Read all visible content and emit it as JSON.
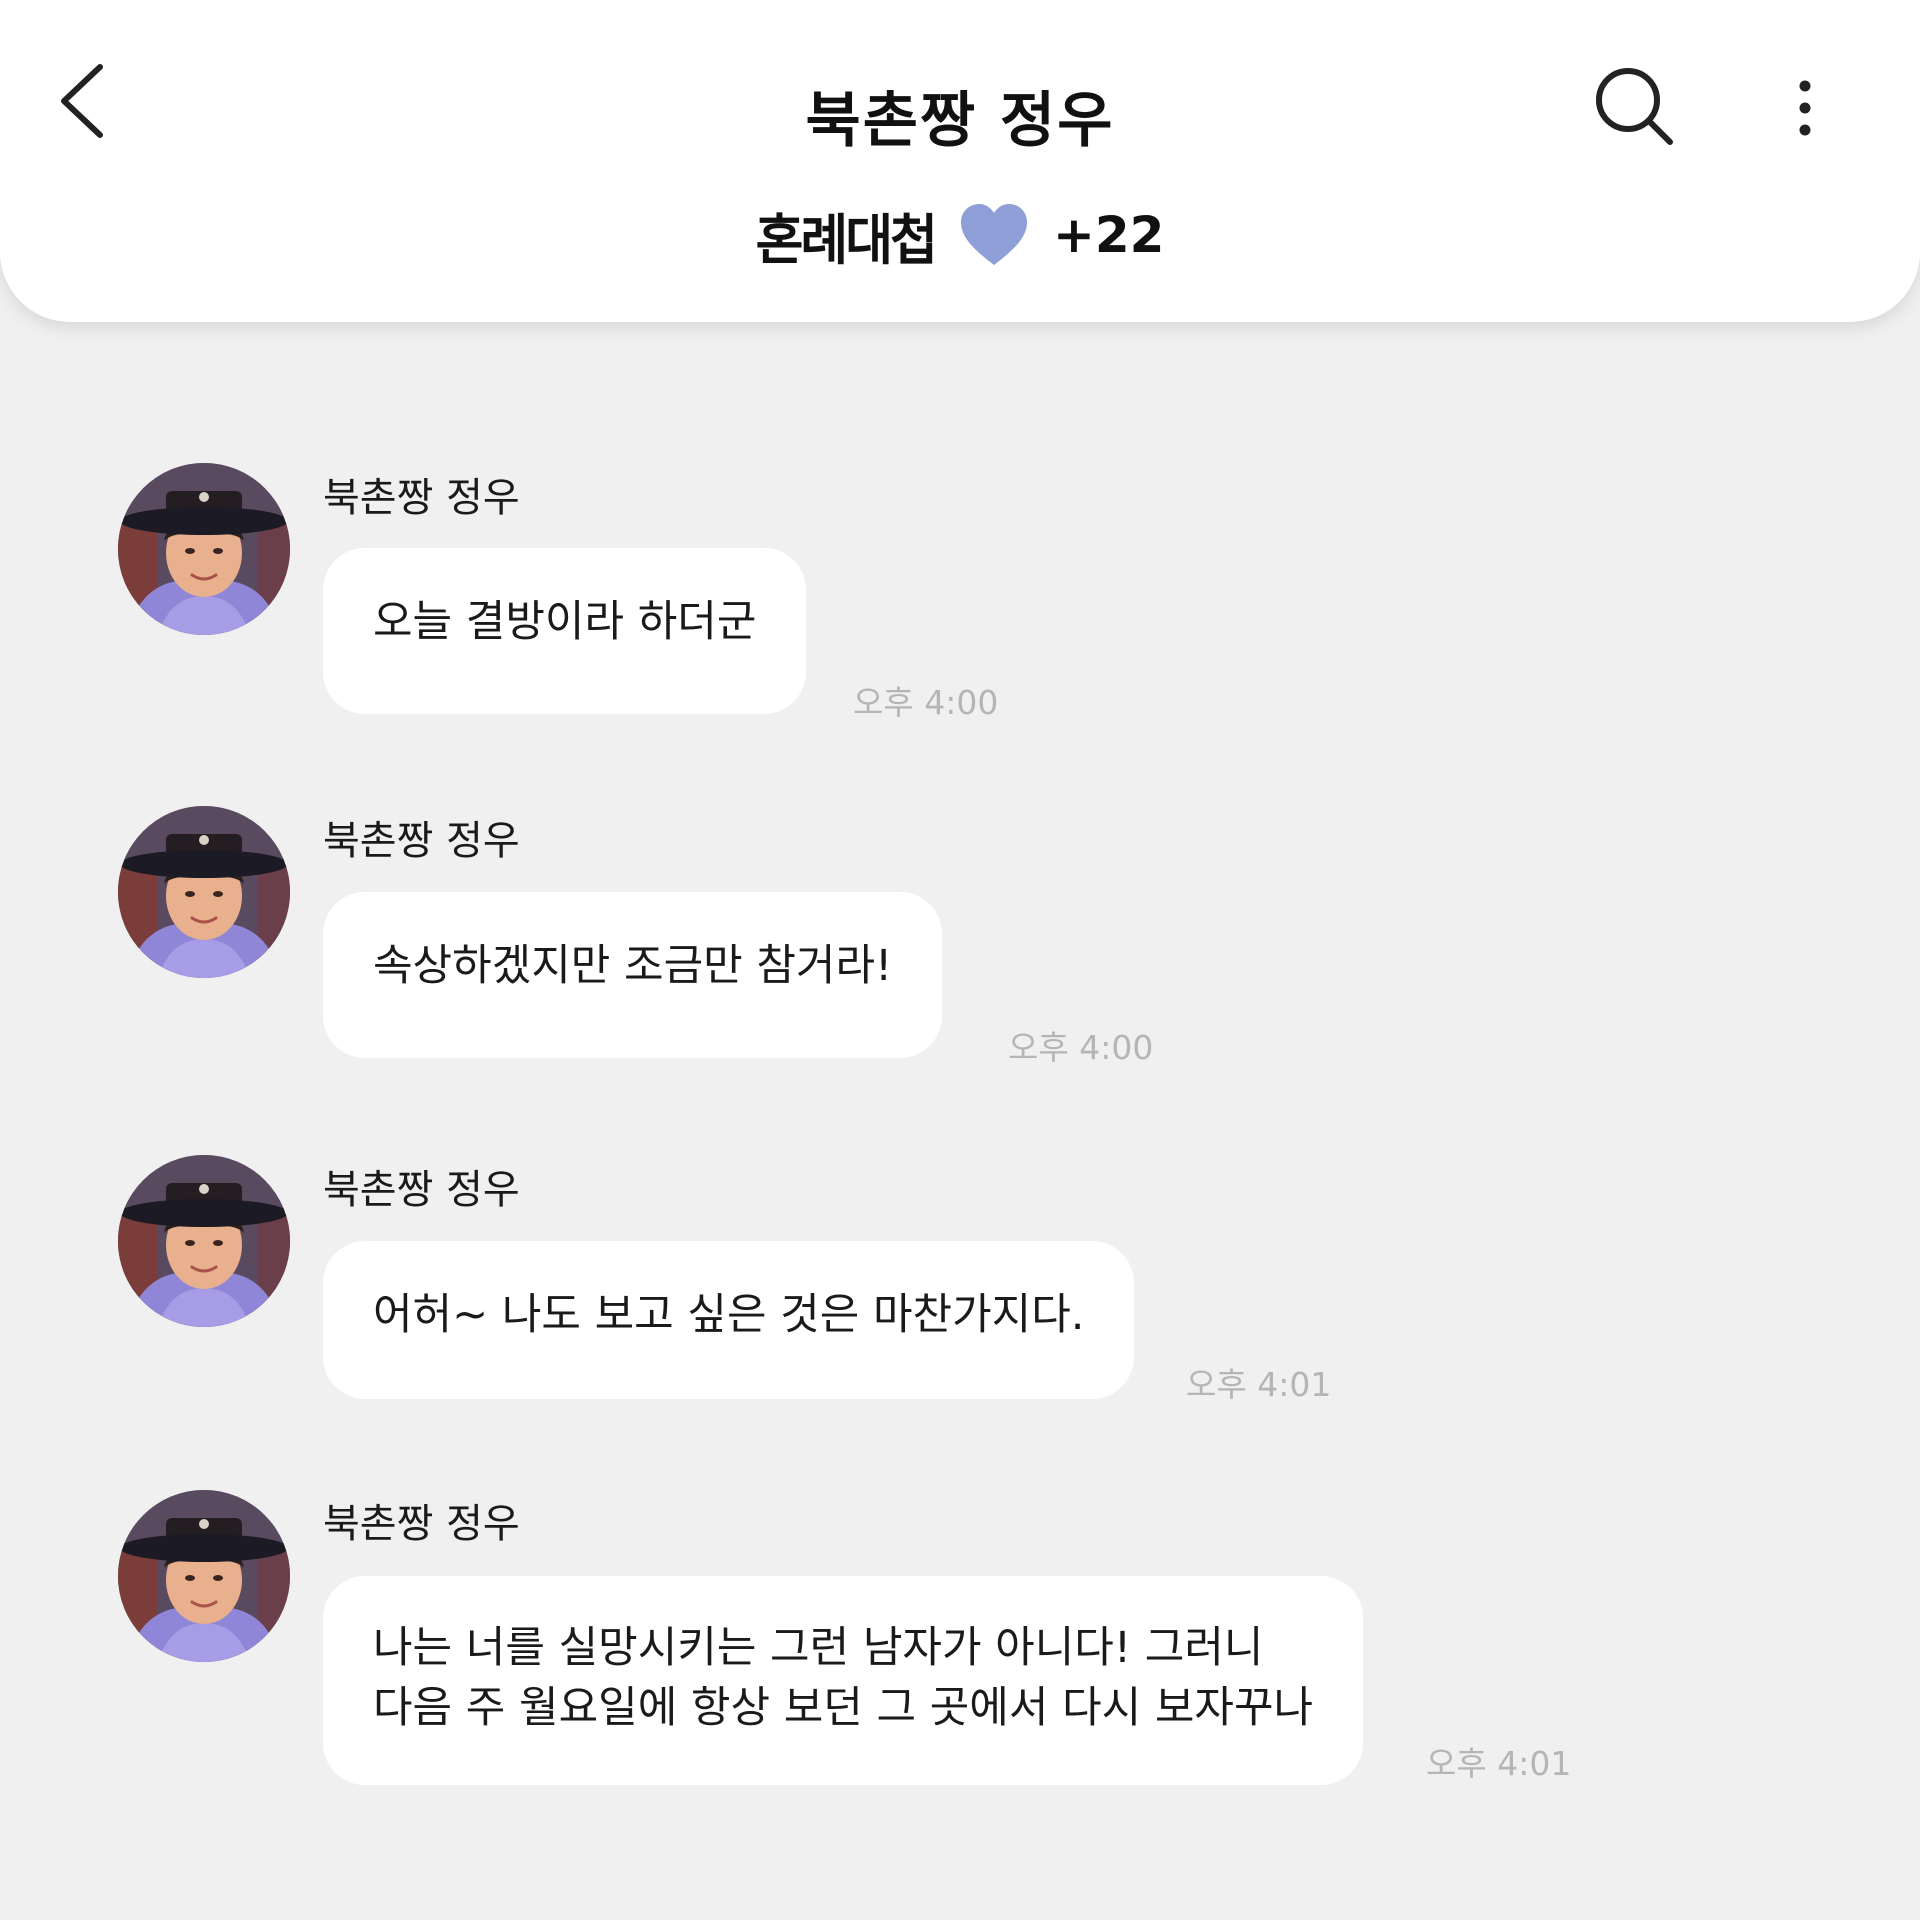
{
  "header": {
    "title": "북촌짱 정우",
    "logo_text": "혼례대첩",
    "heart_color": "#8d9fd6",
    "likes_count": "+22",
    "icons": {
      "back": "chevron-left-icon",
      "search": "search-icon",
      "more": "more-vertical-icon"
    }
  },
  "messages": [
    {
      "sender": "북촌짱 정우",
      "lines": [
        "오늘 결방이라 하더군"
      ],
      "time": "오후 4:00"
    },
    {
      "sender": "북촌짱 정우",
      "lines": [
        "속상하겠지만 조금만 참거라!"
      ],
      "time": "오후 4:00"
    },
    {
      "sender": "북촌짱 정우",
      "lines": [
        "어허~ 나도 보고 싶은 것은 마찬가지다."
      ],
      "time": "오후 4:01"
    },
    {
      "sender": "북촌짱 정우",
      "lines": [
        "나는 너를 실망시키는 그런 남자가 아니다! 그러니",
        "다음 주 월요일에 항상 보던 그 곳에서 다시 보자꾸나"
      ],
      "time": "오후 4:01"
    }
  ]
}
